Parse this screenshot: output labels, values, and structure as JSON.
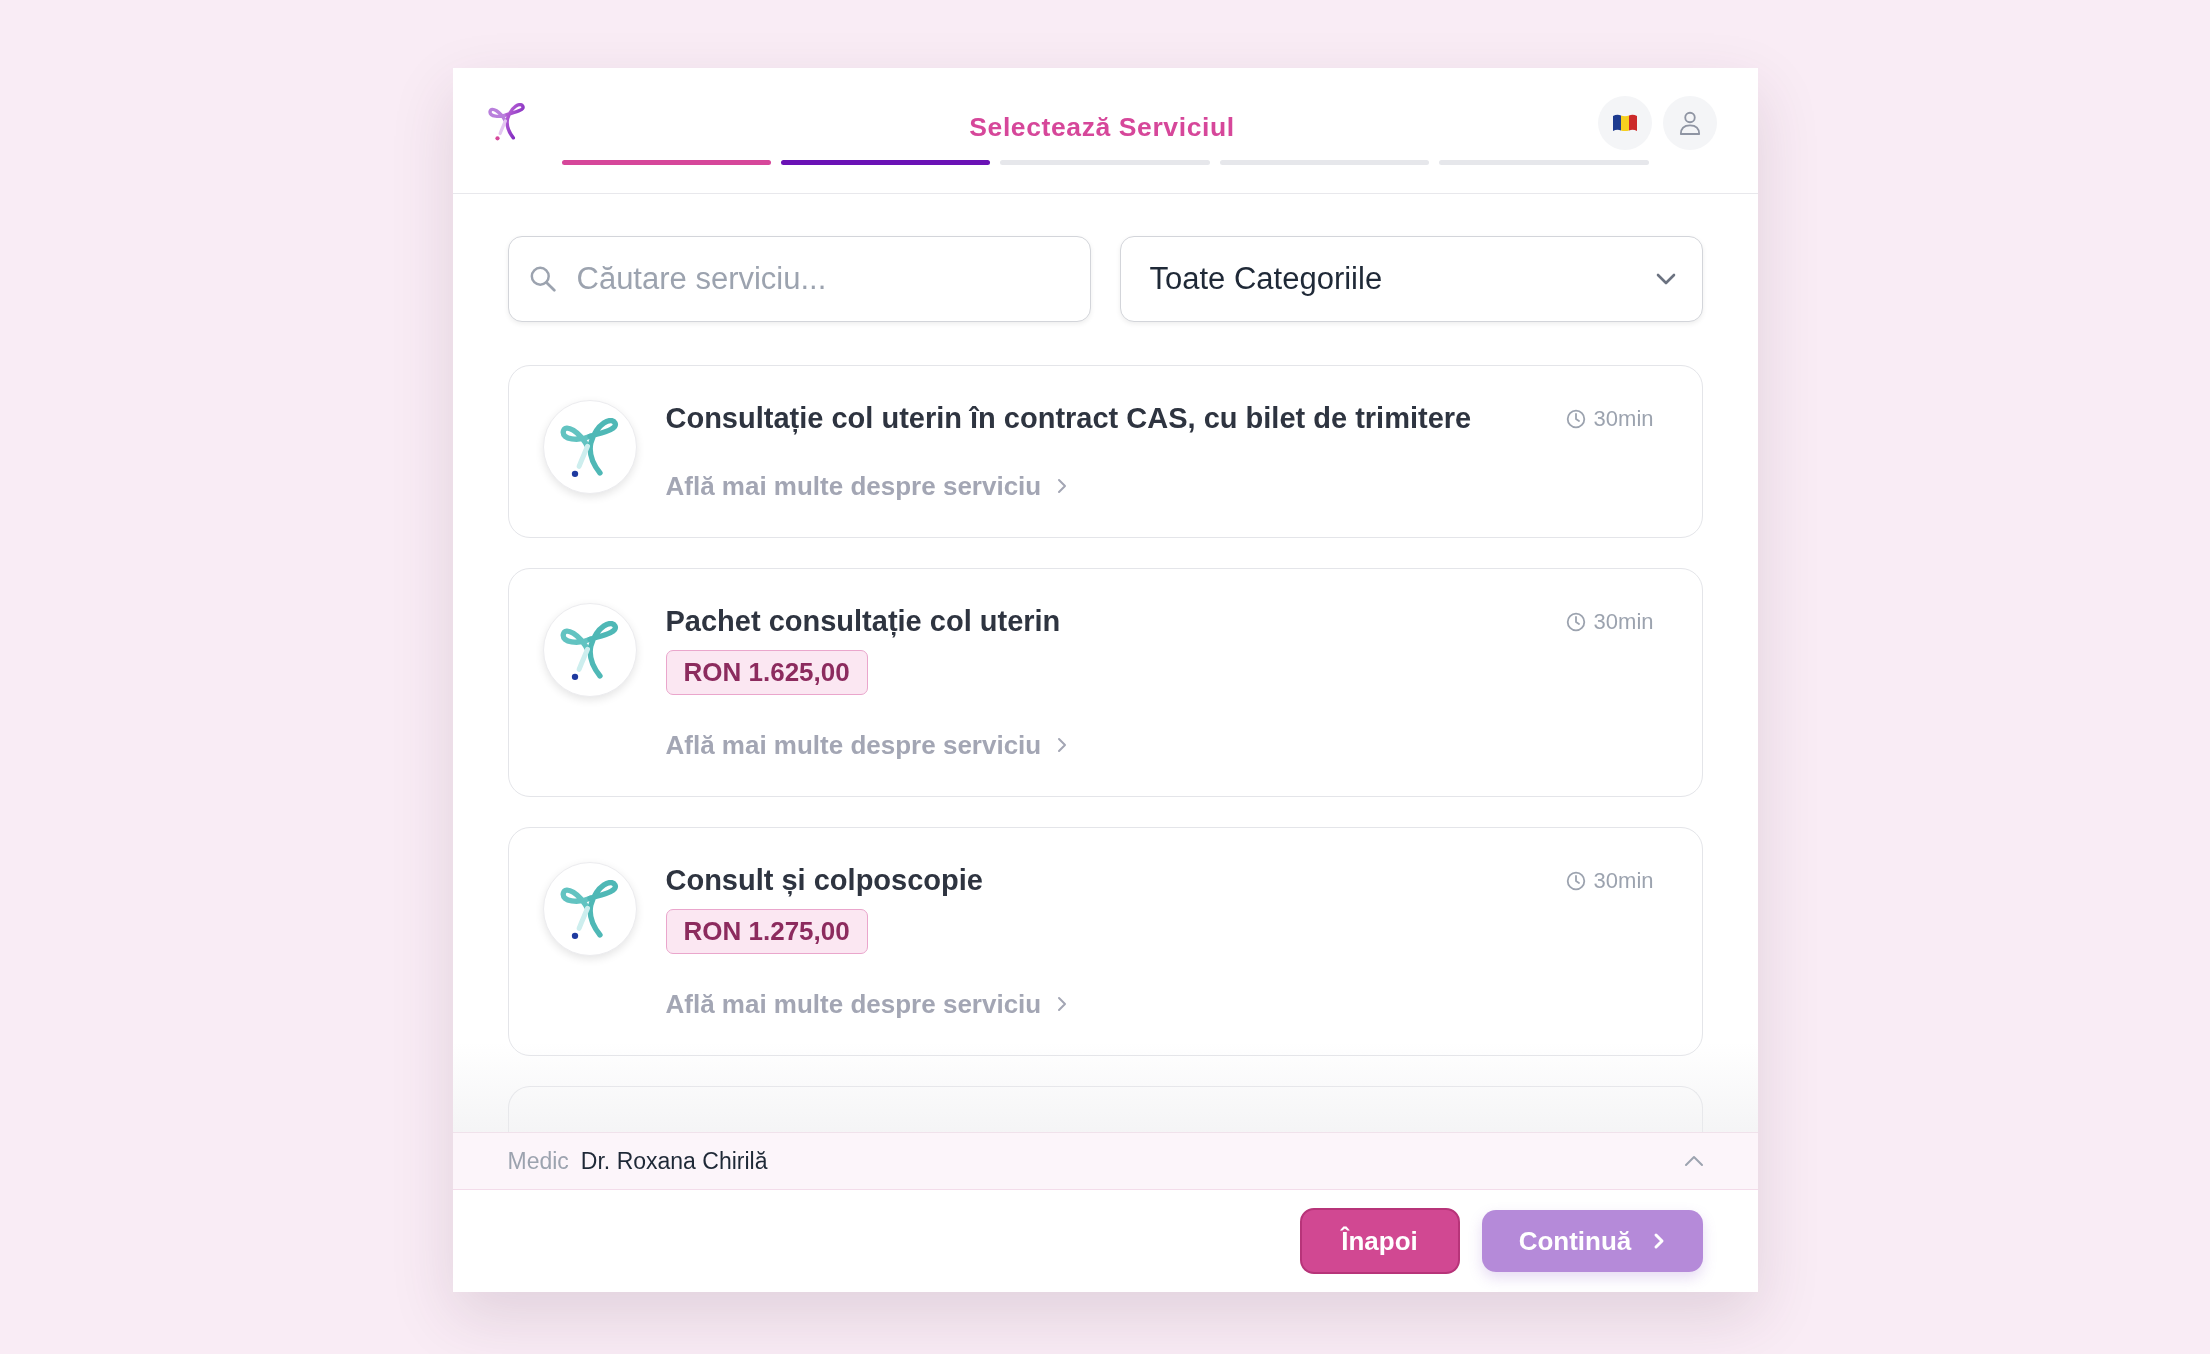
{
  "header": {
    "title": "Selectează Serviciul",
    "steps": [
      {
        "completed": true,
        "selected": false
      },
      {
        "completed": false,
        "selected": true
      },
      {
        "completed": false,
        "selected": false
      },
      {
        "completed": false,
        "selected": false
      },
      {
        "completed": false,
        "selected": false
      }
    ]
  },
  "search": {
    "placeholder": "Căutare serviciu..."
  },
  "category_select": {
    "value": "Toate Categoriile"
  },
  "services": [
    {
      "title": "Consultație col uterin în contract CAS, cu bilet de trimitere",
      "duration": "30min",
      "link": "Află mai multe despre serviciu"
    },
    {
      "title": "Pachet consultație col uterin",
      "duration": "30min",
      "price": "RON 1.625,00",
      "link": "Află mai multe despre serviciu"
    },
    {
      "title": "Consult și colposcopie",
      "duration": "30min",
      "price": "RON 1.275,00",
      "link": "Află mai multe despre serviciu"
    }
  ],
  "doctor_bar": {
    "label": "Medic",
    "value": "Dr. Roxana Chirilă",
    "expanded": false
  },
  "buttons": [
    {
      "label": "Înapoi",
      "kind": "back",
      "disabled": false
    },
    {
      "label": "Continuă",
      "kind": "next",
      "disabled": true
    }
  ]
}
